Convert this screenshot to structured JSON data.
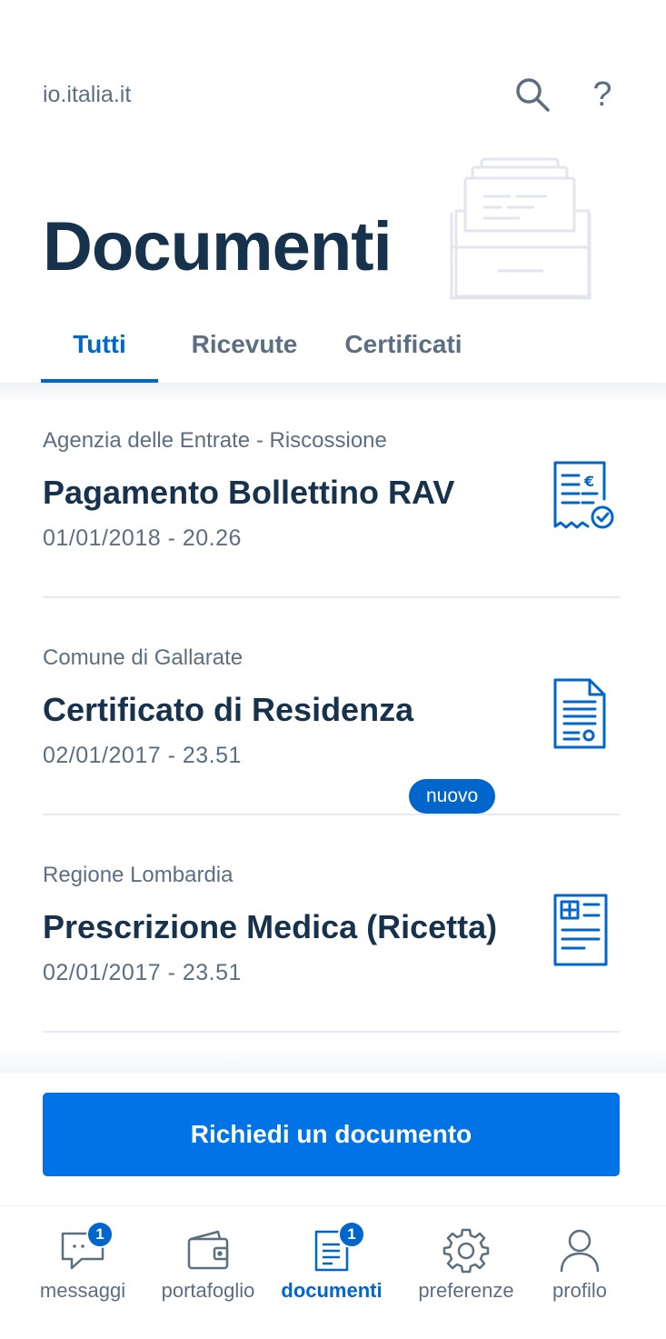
{
  "header": {
    "site": "io.italia.it",
    "search_icon": "search-icon",
    "help_icon": "help-icon",
    "help_glyph": "?"
  },
  "page": {
    "title": "Documenti",
    "illustration_icon": "document-drawer-illustration"
  },
  "tabs": [
    {
      "label": "Tutti",
      "active": true
    },
    {
      "label": "Ricevute",
      "active": false
    },
    {
      "label": "Certificati",
      "active": false
    }
  ],
  "documents": [
    {
      "issuer": "Agenzia delle Entrate - Riscossione",
      "name": "Pagamento Bollettino RAV",
      "date": "01/01/2018 - 20.26",
      "icon": "receipt-euro-check-icon"
    },
    {
      "issuer": "Comune di Gallarate",
      "name": "Certificato di Residenza",
      "date": "02/01/2017 - 23.51",
      "icon": "certificate-icon",
      "badge": "nuovo"
    },
    {
      "issuer": "Regione Lombardia",
      "name": "Prescrizione Medica (Ricetta)",
      "date": "02/01/2017 - 23.51",
      "icon": "medical-prescription-icon"
    }
  ],
  "cta": {
    "label": "Richiedi un documento"
  },
  "navbar": [
    {
      "label": "messaggi",
      "icon": "messages-icon",
      "badge": "1",
      "active": false
    },
    {
      "label": "portafoglio",
      "icon": "wallet-icon",
      "active": false
    },
    {
      "label": "documenti",
      "icon": "documents-icon",
      "badge": "1",
      "active": true
    },
    {
      "label": "preferenze",
      "icon": "gear-icon",
      "active": false
    },
    {
      "label": "profilo",
      "icon": "profile-icon",
      "active": false
    }
  ],
  "colors": {
    "accent": "#0066cc",
    "title": "#17324d",
    "muted": "#5c6f82"
  }
}
